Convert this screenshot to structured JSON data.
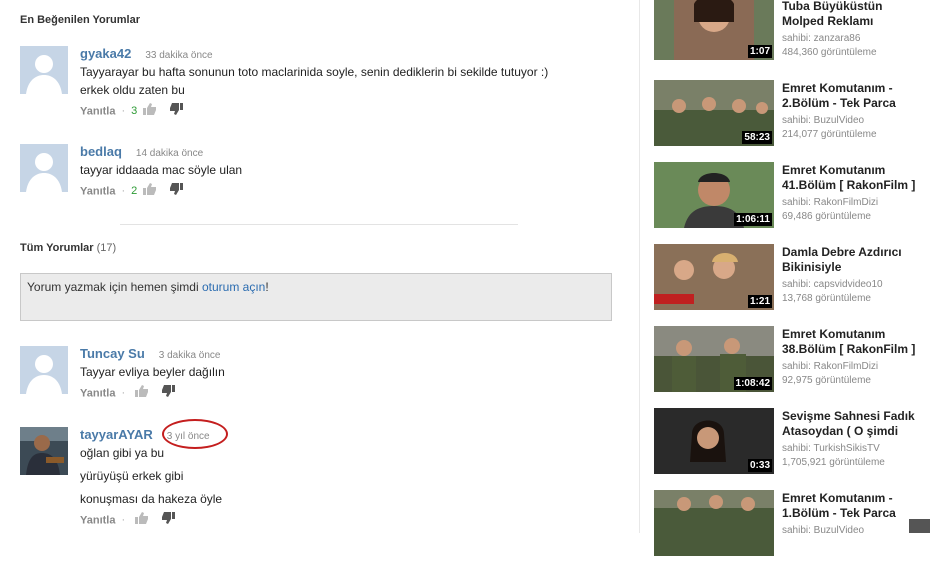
{
  "top_comments": {
    "title": "En Beğenilen Yorumlar",
    "items": [
      {
        "author": "gyaka42",
        "time": "33 dakika önce",
        "lines": [
          "Tayyarayar bu hafta sonunun toto maclarinida soyle, senin dediklerin bi sekilde tutuyor :)",
          "erkek oldu zaten bu"
        ],
        "reply": "Yanıtla",
        "likes": "3"
      },
      {
        "author": "bedlaq",
        "time": "14 dakika önce",
        "lines": [
          "tayyar iddaada mac söyle ulan"
        ],
        "reply": "Yanıtla",
        "likes": "2"
      }
    ]
  },
  "all_comments": {
    "title": "Tüm Yorumlar",
    "count": "(17)",
    "compose_prefix": "Yorum yazmak için hemen şimdi ",
    "compose_link": "oturum açın",
    "compose_suffix": "!",
    "items": [
      {
        "author": "Tuncay Su",
        "time": "3 dakika önce",
        "lines": [
          "Tayyar evliya beyler dağılın"
        ],
        "reply": "Yanıtla"
      },
      {
        "author": "tayyarAYAR",
        "time": "3 yıl önce",
        "lines": [
          "oğlan gibi ya bu",
          "yürüyüşü erkek gibi",
          "konuşması da hakeza öyle"
        ],
        "reply": "Yanıtla"
      }
    ]
  },
  "annotation_color": "#c41e1e",
  "sidebar": {
    "videos": [
      {
        "title1": "Tuba Büyüküstün",
        "title2": "Molped Reklamı",
        "user": "sahibi: zanzara86",
        "views": "484,360 görüntüleme",
        "duration": "1:07"
      },
      {
        "title1": "Emret Komutanım -",
        "title2": "2.Bölüm - Tek Parca",
        "user": "sahibi: BuzulVideo",
        "views": "214,077 görüntüleme",
        "duration": "58:23"
      },
      {
        "title1": "Emret Komutanım",
        "title2": "41.Bölüm [ RakonFilm ]",
        "user": "sahibi: RakonFilmDizi",
        "views": "69,486 görüntüleme",
        "duration": "1:06:11"
      },
      {
        "title1": "Damla Debre Azdırıcı",
        "title2": "Bikinisiyle",
        "user": "sahibi: capsvidvideo10",
        "views": "13,768 görüntüleme",
        "duration": "1:21"
      },
      {
        "title1": "Emret Komutanım",
        "title2": "38.Bölüm [ RakonFilm ]",
        "user": "sahibi: RakonFilmDizi",
        "views": "92,975 görüntüleme",
        "duration": "1:08:42"
      },
      {
        "title1": "Sevişme Sahnesi Fadık",
        "title2": "Atasoydan ( O şimdi",
        "user": "sahibi: TurkishSikisTV",
        "views": "1,705,921 görüntüleme",
        "duration": "0:33"
      },
      {
        "title1": "Emret Komutanım -",
        "title2": "1.Bölüm - Tek Parca",
        "user": "sahibi: BuzulVideo",
        "views": "",
        "duration": ""
      }
    ]
  }
}
